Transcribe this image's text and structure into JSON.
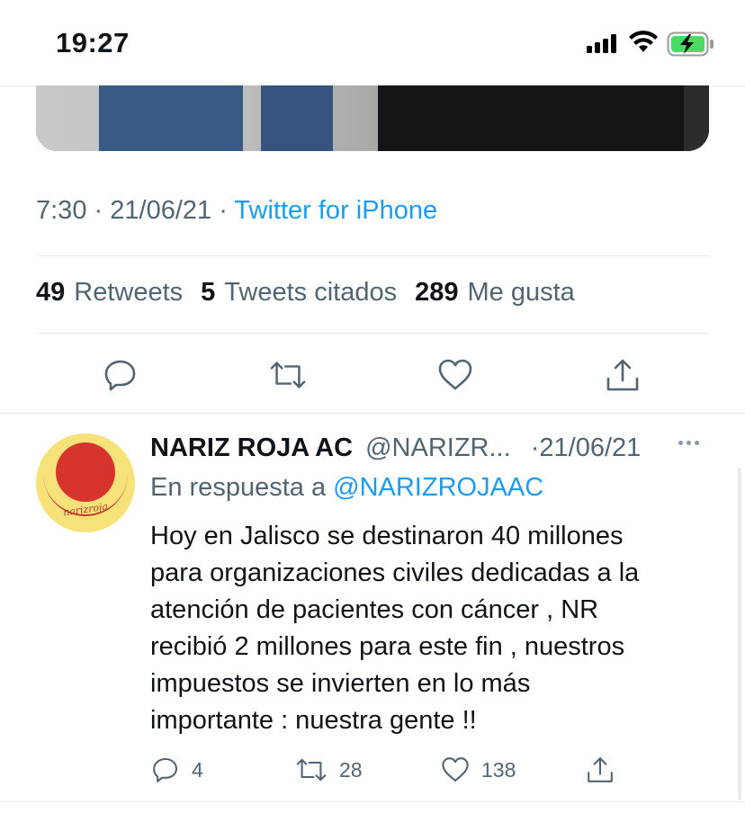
{
  "status_bar": {
    "time": "19:27",
    "icons": [
      "signal-bars-icon",
      "wifi-icon",
      "battery-charging-icon"
    ],
    "battery_color": "#4cd964"
  },
  "tweet": {
    "time": "7:30",
    "separator": "·",
    "date": "21/06/21",
    "source": "Twitter for iPhone",
    "stats": [
      {
        "count": "49",
        "label": "Retweets"
      },
      {
        "count": "5",
        "label": "Tweets citados"
      },
      {
        "count": "289",
        "label": "Me gusta"
      }
    ],
    "actions": [
      "reply-icon",
      "retweet-icon",
      "like-icon",
      "share-icon"
    ]
  },
  "reply": {
    "name": "NARIZ ROJA AC",
    "handle": "@NARIZR...",
    "date": "·21/06/21",
    "reply_prefix": "En respuesta a",
    "reply_mention": "@NARIZROJAAC",
    "text_lines": [
      "Hoy en Jalisco se destinaron 40 millones",
      "para organizaciones civiles dedicadas a la",
      "atención de pacientes con cáncer , NR",
      "recibió 2 millones para este fin , nuestros",
      "impuestos se invierten en lo más",
      "importante : nuestra gente !!"
    ],
    "avatar_text": "narizroja",
    "counts": {
      "replies": "4",
      "retweets": "28",
      "likes": "138"
    }
  },
  "colors": {
    "accent": "#1d9bf0",
    "secondary_text": "#536471",
    "primary_text": "#0f1419",
    "divider": "#e6ecf0"
  }
}
